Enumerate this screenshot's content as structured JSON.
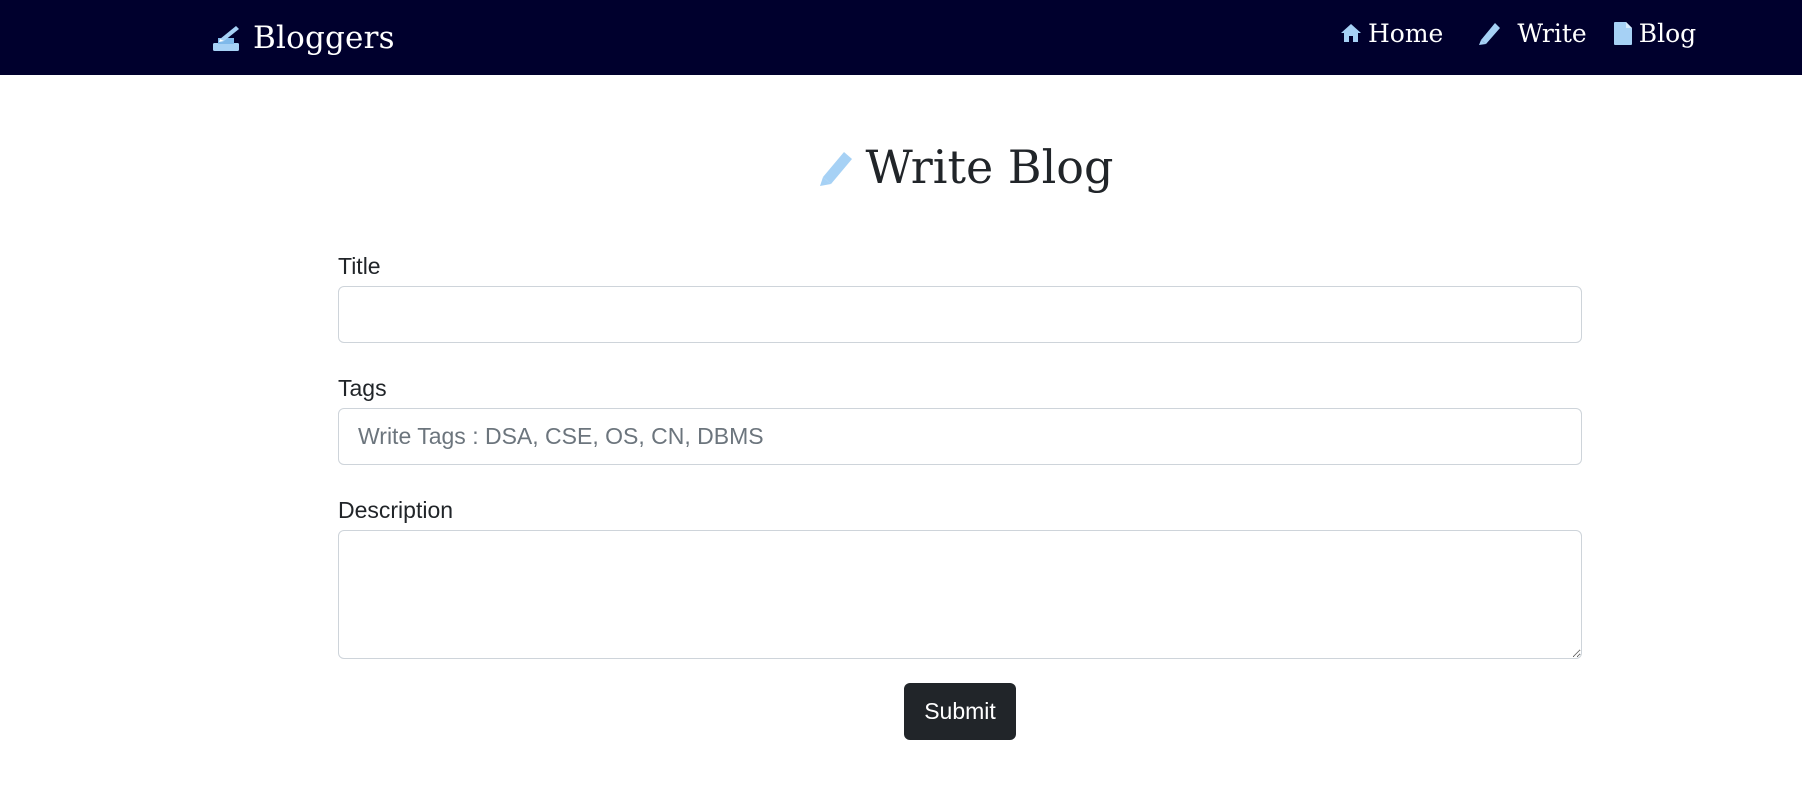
{
  "navbar": {
    "brand": {
      "label": "Bloggers",
      "icon": "writing-desk-icon"
    },
    "links": [
      {
        "label": "Home",
        "icon": "home-icon"
      },
      {
        "label": "Write",
        "icon": "pencil-icon"
      },
      {
        "label": "Blog",
        "icon": "file-icon"
      }
    ]
  },
  "page": {
    "heading": "Write Blog",
    "heading_icon": "pencil-icon"
  },
  "form": {
    "title": {
      "label": "Title",
      "value": "",
      "placeholder": ""
    },
    "tags": {
      "label": "Tags",
      "value": "",
      "placeholder": "Write Tags : DSA, CSE, OS, CN, DBMS"
    },
    "description": {
      "label": "Description",
      "value": "",
      "placeholder": ""
    },
    "submit_label": "Submit"
  },
  "colors": {
    "navbar_bg": "#00002d",
    "icon_light_blue": "#a6d1f5",
    "button_bg": "#212529"
  }
}
